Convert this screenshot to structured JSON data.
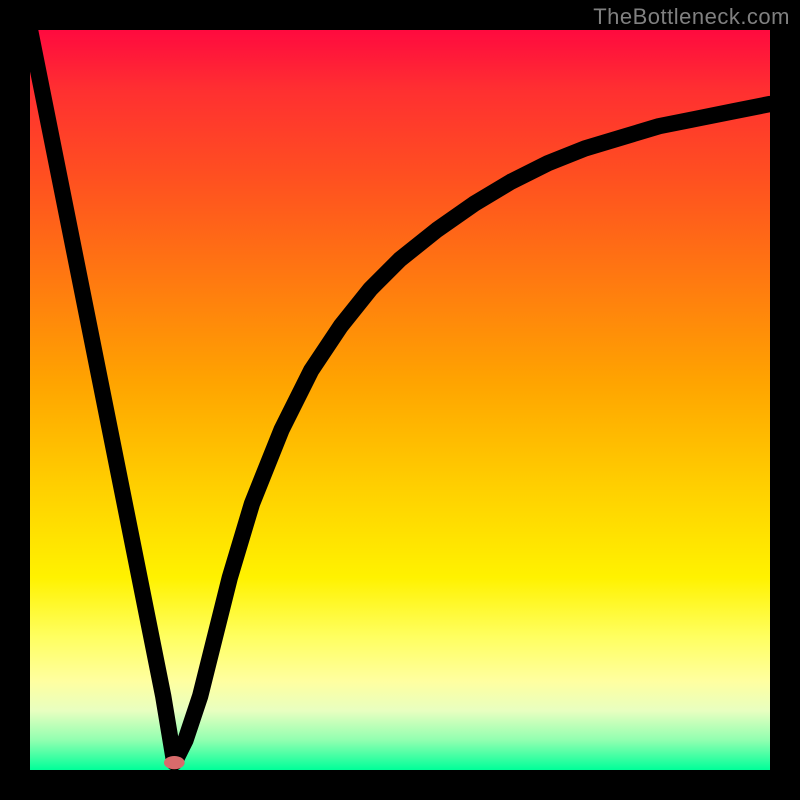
{
  "watermark": "TheBottleneck.com",
  "chart_data": {
    "type": "line",
    "title": "",
    "xlabel": "",
    "ylabel": "",
    "xlim": [
      0,
      100
    ],
    "ylim": [
      0,
      100
    ],
    "background_gradient": {
      "top": "#ff0a3f",
      "bottom": "#00ff99",
      "meaning": "high value (top) = red / bottleneck, low value (bottom) = green / balanced"
    },
    "series": [
      {
        "name": "bottleneck-curve",
        "color": "#000000",
        "x": [
          0,
          2,
          4,
          6,
          8,
          10,
          12,
          14,
          16,
          18,
          19.5,
          21,
          23,
          25,
          27,
          30,
          34,
          38,
          42,
          46,
          50,
          55,
          60,
          65,
          70,
          75,
          80,
          85,
          90,
          95,
          100
        ],
        "y": [
          100,
          90,
          80,
          70,
          60,
          50,
          40,
          30,
          20,
          10,
          1,
          4,
          10,
          18,
          26,
          36,
          46,
          54,
          60,
          65,
          69,
          73,
          76.5,
          79.5,
          82,
          84,
          85.5,
          87,
          88,
          89,
          90
        ]
      }
    ],
    "marker": {
      "name": "optimal-point",
      "x": 19.5,
      "y": 1,
      "color": "#d86b6b",
      "rx": 1.4,
      "ry": 0.9
    }
  }
}
